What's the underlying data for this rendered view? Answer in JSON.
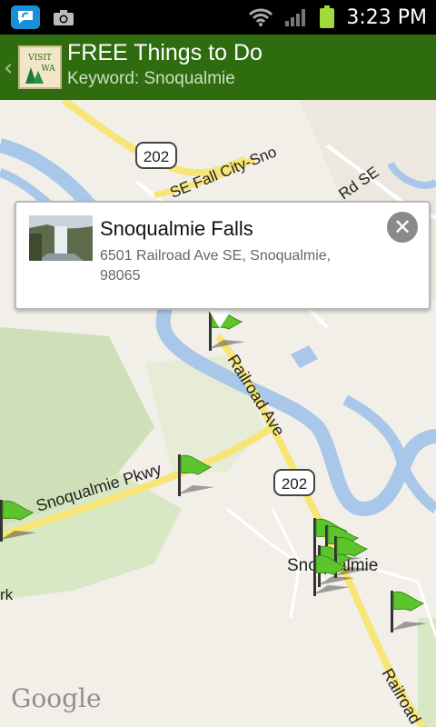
{
  "status_bar": {
    "time": "3:23 PM"
  },
  "header": {
    "title": "FREE Things to Do",
    "subtitle": "Keyword: Snoqualmie",
    "logo_text": [
      "VISIT",
      "WA"
    ]
  },
  "map": {
    "labels": {
      "route_202_top": "202",
      "route_202_mid": "202",
      "road_city_se": "SE Fall City-Sno",
      "road_rd_se": "Rd SE",
      "road_railroad_ave": "Railroad Ave",
      "road_railroad_ave_lower": "Railroad Ave",
      "road_snoqualmie_pkwy": "Snoqualmie Pkwy",
      "town_snoqualmie": "Snoqualmie",
      "edge_label": "rk"
    },
    "attribution": "Google",
    "marker_color": "#5cc42d"
  },
  "popup": {
    "title": "Snoqualmie Falls",
    "address": "6501 Railroad Ave SE, Snoqualmie, 98065",
    "close_icon": "close-circle-icon"
  }
}
